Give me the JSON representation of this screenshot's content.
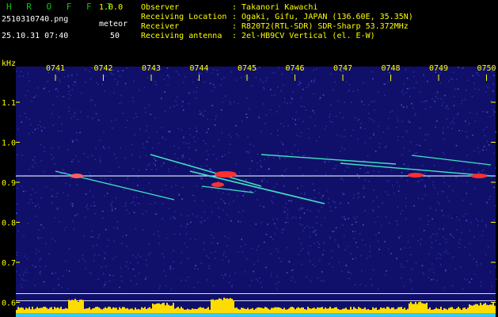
{
  "header": {
    "app_title": "H R O F F T",
    "app_version": "1.0.0",
    "filename": "2510310740.png",
    "meteor_label": "meteor",
    "datetime": "25.10.31 07:40",
    "meteor_count": "50",
    "info": [
      {
        "key": "Observer",
        "value": ": Takanori Kawachi"
      },
      {
        "key": "Receiving Location",
        "value": ": Ogaki, Gifu, JAPAN (136.60E, 35.35N)"
      },
      {
        "key": "Receiver",
        "value": ": R820T2(RTL-SDR) SDR-Sharp 53.372MHz"
      },
      {
        "key": "Receiving antenna",
        "value": ": 2el-HB9CV Vertical (el. E-W)"
      }
    ]
  },
  "spectrogram": {
    "unit_label": "kHz",
    "time_labels": [
      "0741",
      "0742",
      "0743",
      "0744",
      "0745",
      "0746",
      "0747",
      "0748",
      "0749",
      "0750"
    ],
    "freq_labels": [
      "1.1",
      "1.0",
      "0.9",
      "0.8",
      "0.7",
      "0.6"
    ],
    "colors": {
      "background": "#10106a",
      "noise": "#3040c8",
      "carrier": "#e8f0ff",
      "trail": "#40e0c0",
      "head": "#ff3030",
      "power": "#ffdc00",
      "power_base": "#30c8ff"
    }
  }
}
